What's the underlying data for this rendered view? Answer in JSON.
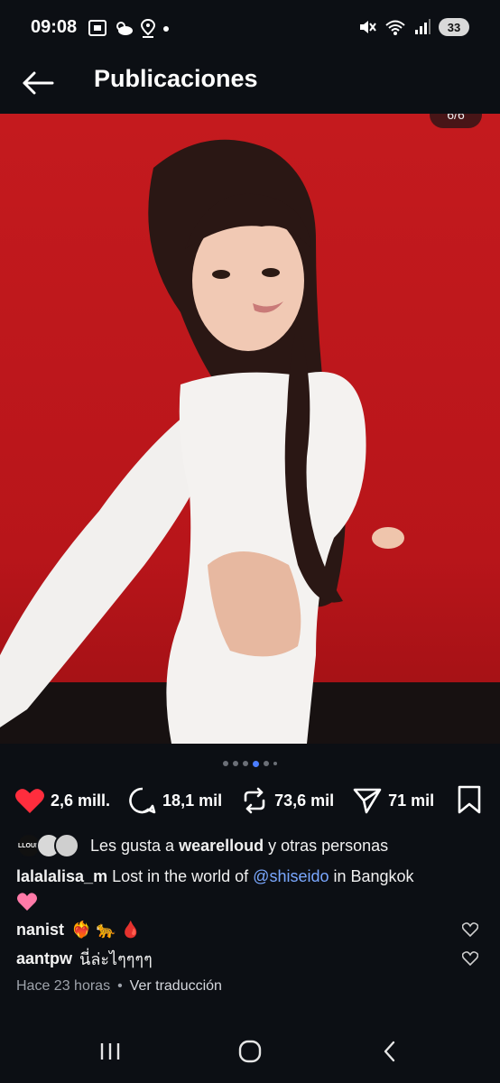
{
  "status_bar": {
    "time": "09:08",
    "battery": "33",
    "left_icons": [
      "screenshot-icon",
      "weather-icon",
      "location-icon",
      "dot-icon"
    ],
    "right_icons": [
      "mute-icon",
      "wifi-icon",
      "signal-icon",
      "battery-icon"
    ]
  },
  "header": {
    "title": "Publicaciones",
    "back_icon": "arrow-left-icon"
  },
  "post": {
    "page_counter": "6/6",
    "carousel": {
      "total_dots": 6,
      "active_index": 3
    },
    "actions": {
      "likes": "2,6 mill.",
      "comments": "18,1 mil",
      "reposts": "73,6 mil",
      "shares": "71 mil"
    },
    "liked_by": {
      "avatar_label": "LLOUD",
      "prefix": "Les gusta a ",
      "user": "wearelloud",
      "suffix": " y otras personas"
    },
    "caption": {
      "username": "lalalalisa_m",
      "text_before": " Lost in the world of ",
      "mention": "@shiseido",
      "text_after": " in Bangkok"
    },
    "comments": [
      {
        "username": "nanist",
        "text": "❤️‍🔥 🐆 🩸"
      },
      {
        "username": "aantpw",
        "text": "นี่ล่ะไๆๆๆๆ"
      }
    ],
    "timestamp": "Hace 23 horas",
    "separator": "•",
    "translate": "Ver traducción"
  },
  "colors": {
    "background": "#0c0f14",
    "photo_bg": "#c41a1e",
    "heart": "#ff2d3d",
    "mention": "#7aa8ff",
    "active_dot": "#4a7dff"
  }
}
